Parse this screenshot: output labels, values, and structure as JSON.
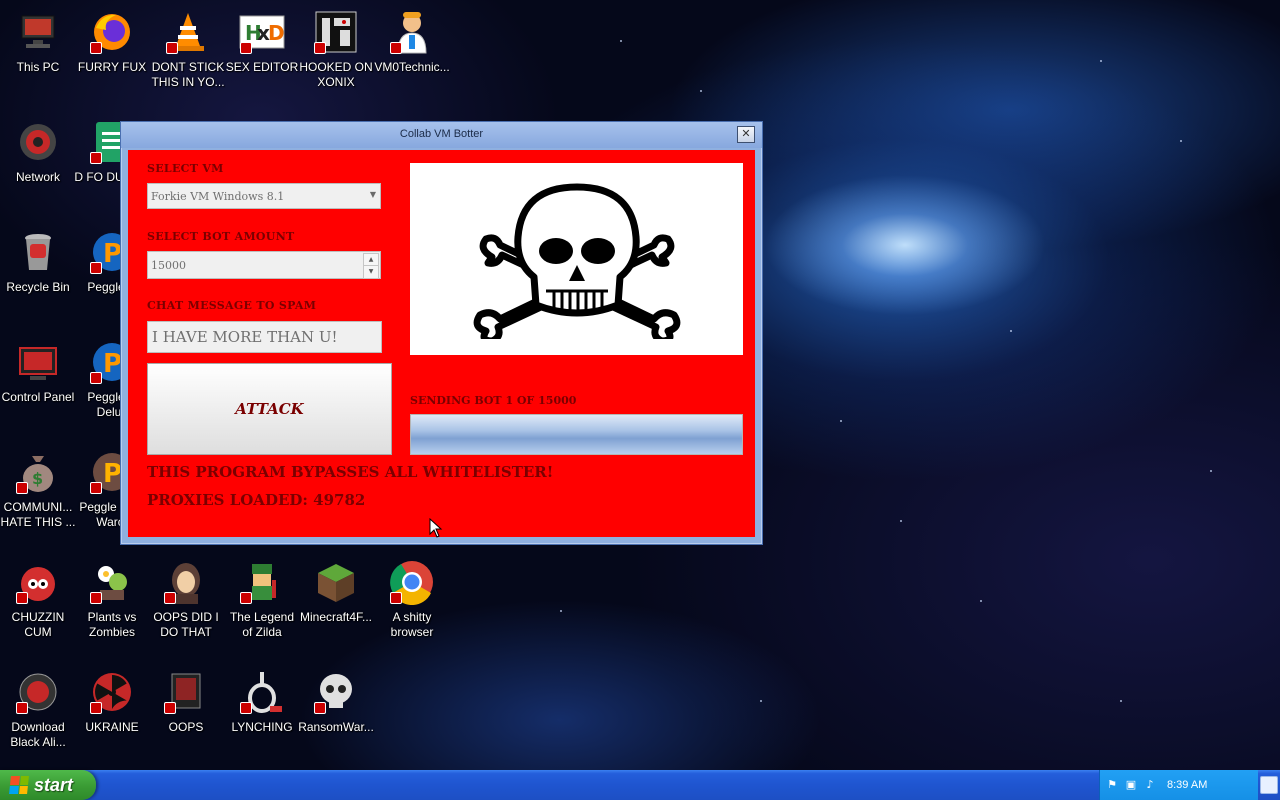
{
  "desktop": {
    "icons": [
      {
        "label": "This PC",
        "icon": "computer-icon"
      },
      {
        "label": "FURRY FUX",
        "icon": "firefox-icon"
      },
      {
        "label": "DONT STICK THIS IN YO...",
        "icon": "vlc-cone-icon"
      },
      {
        "label": "SEX EDITOR",
        "icon": "hxd-hex-editor-icon"
      },
      {
        "label": "HOOKED ON XONIX",
        "icon": "xonix-game-icon"
      },
      {
        "label": "VM0Technic...",
        "icon": "technician-icon"
      },
      {
        "label": "Network",
        "icon": "network-icon"
      },
      {
        "label": "D FO DUMBA",
        "icon": "document-icon"
      },
      {
        "label": "Recycle Bin",
        "icon": "recycle-bin-icon"
      },
      {
        "label": "Peggle D",
        "icon": "peggle-icon"
      },
      {
        "label": "Control Panel",
        "icon": "control-panel-icon"
      },
      {
        "label": "Peggle N Delux",
        "icon": "peggle-icon"
      },
      {
        "label": "COMMUNI... HATE THIS ...",
        "icon": "money-bag-icon"
      },
      {
        "label": "Peggle W of Warcr",
        "icon": "peggle-icon"
      },
      {
        "label": "CHUZZIN CUM",
        "icon": "chuzzle-icon"
      },
      {
        "label": "Plants vs Zombies",
        "icon": "plants-vs-zombies-icon"
      },
      {
        "label": "OOPS DID I DO THAT",
        "icon": "portrait-icon"
      },
      {
        "label": "The Legend of Zilda",
        "icon": "zelda-character-icon"
      },
      {
        "label": "Minecraft4F...",
        "icon": "minecraft-block-icon"
      },
      {
        "label": "A shitty browser",
        "icon": "chrome-icon"
      },
      {
        "label": "Download Black Ali...",
        "icon": "alien-icon"
      },
      {
        "label": "UKRAINE",
        "icon": "radiation-icon"
      },
      {
        "label": "OOPS",
        "icon": "app-icon"
      },
      {
        "label": "LYNCHING",
        "icon": "rope-icon"
      },
      {
        "label": "RansomWar...",
        "icon": "skull-helmet-icon"
      }
    ]
  },
  "window": {
    "title": "Collab VM Botter",
    "close_glyph": "✕",
    "select_vm_label": "SELECT VM",
    "select_vm_value": "Forkie VM Windows 8.1",
    "bot_amount_label": "SELECT BOT AMOUNT",
    "bot_amount_value": "15000",
    "chat_label": "CHAT MESSAGE TO SPAM",
    "chat_value": "I HAVE MORE THAN U!",
    "attack_label": "ATTACK",
    "status_text": "SENDING BOT 1 OF 15000",
    "progress_fraction": 1.0,
    "bypass_text": "THIS PROGRAM BYPASSES ALL WHITELISTER!",
    "proxies_text": "PROXIES LOADED: 49782",
    "image_icon": "skull-and-crossbones-icon"
  },
  "taskbar": {
    "start_label": "start",
    "clock": "8:39 AM"
  },
  "colors": {
    "window_bg": "#ff0000",
    "label_color": "#7a0000",
    "taskbar_blue": "#245edb",
    "start_green": "#3a9b34"
  }
}
